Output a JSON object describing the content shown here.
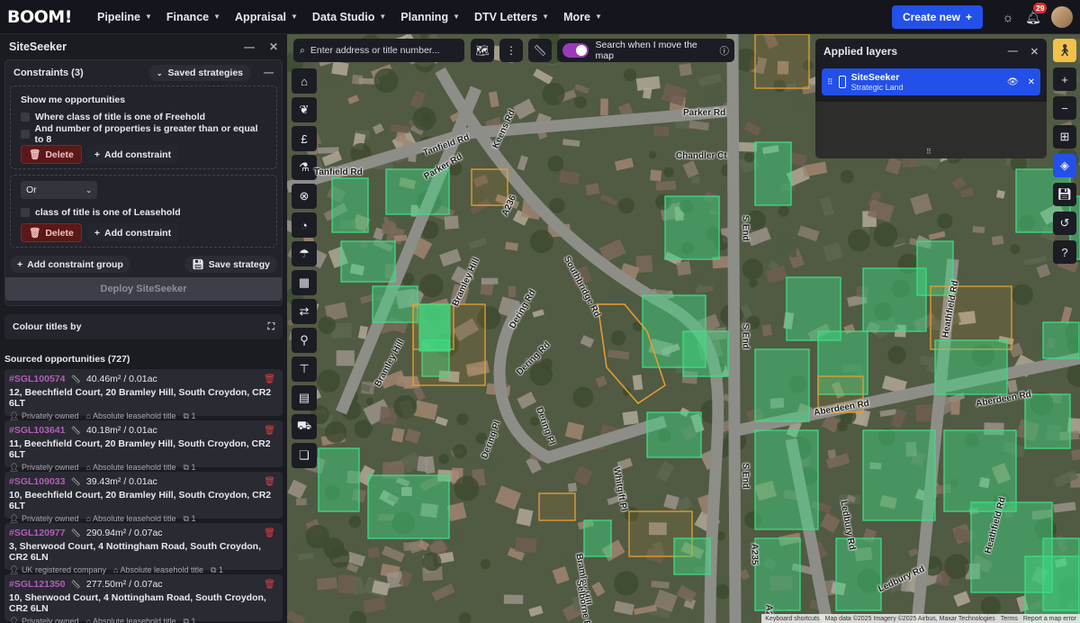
{
  "topbar": {
    "logo": "BOOM!",
    "nav": [
      "Pipeline",
      "Finance",
      "Appraisal",
      "Data Studio",
      "Planning",
      "DTV Letters",
      "More"
    ],
    "create_label": "Create new",
    "notification_count": "29",
    "icons": [
      "plus-icon",
      "sun-icon",
      "bell-icon",
      "avatar"
    ]
  },
  "panel": {
    "title": "SiteSeeker",
    "constraints_label": "Constraints (3)",
    "saved_strategies": "Saved strategies",
    "group1": {
      "heading": "Show me opportunities",
      "rows": [
        "Where class of title is one of Freehold",
        "And number of properties is greater than or equal to 8"
      ]
    },
    "group2": {
      "operator": "Or",
      "rows": [
        "class of title is one of Leasehold"
      ]
    },
    "delete_label": "Delete",
    "add_constraint_label": "Add constraint",
    "add_group_label": "Add constraint group",
    "save_strategy_label": "Save strategy",
    "deploy_label": "Deploy SiteSeeker",
    "colour_label": "Colour titles by",
    "sourced_label": "Sourced opportunities (727)",
    "opportunities": [
      {
        "id": "#SGL100574",
        "area": "40.46m² / 0.01ac",
        "address": "12, Beechfield Court, 20 Bramley Hill, South Croydon, CR2 6LT",
        "owner": "Privately owned",
        "tenure": "Absolute leasehold title",
        "count": "1"
      },
      {
        "id": "#SGL103641",
        "area": "40.18m² / 0.01ac",
        "address": "11, Beechfield Court, 20 Bramley Hill, South Croydon, CR2 6LT",
        "owner": "Privately owned",
        "tenure": "Absolute leasehold title",
        "count": "1"
      },
      {
        "id": "#SGL109033",
        "area": "39.43m² / 0.01ac",
        "address": "10, Beechfield Court, 20 Bramley Hill, South Croydon, CR2 6LT",
        "owner": "Privately owned",
        "tenure": "Absolute leasehold title",
        "count": "1"
      },
      {
        "id": "#SGL120977",
        "area": "290.94m² / 0.07ac",
        "address": "3, Sherwood Court, 4 Nottingham Road, South Croydon, CR2 6LN",
        "owner": "UK registered company",
        "tenure": "Absolute leasehold title",
        "count": "1"
      },
      {
        "id": "#SGL121350",
        "area": "277.50m² / 0.07ac",
        "address": "10, Sherwood Court, 4 Nottingham Road, South Croydon, CR2 6LN",
        "owner": "Privately owned",
        "tenure": "Absolute leasehold title",
        "count": "1"
      }
    ]
  },
  "map": {
    "search_placeholder": "Enter address or title number...",
    "search_move_label": "Search when I move the map",
    "layers_title": "Applied layers",
    "layer_name": "SiteSeeker",
    "layer_sub": "Strategic Land",
    "attribution": [
      "Keyboard shortcuts",
      "Map data ©2025 Imagery ©2025 Airbus, Maxar Technologies",
      "Terms",
      "Report a map error"
    ],
    "roads": [
      "Parker Rd",
      "Keens Rd",
      "Tanfield Rd",
      "Tanfield Rd",
      "Parker Rd",
      "Chandler Ct",
      "A236",
      "Southbridge Rd",
      "Bramley Hill",
      "Bramley Hill",
      "Dering Rd",
      "Dering Rd",
      "Dering Pl",
      "Dering Pl",
      "Whitgift Pl",
      "Bramley Hill",
      "S End",
      "S End",
      "S End",
      "A235",
      "A235",
      "Heathfield Rd",
      "Heathfield Rd",
      "Aberdeen Rd",
      "Aberdeen Rd",
      "Ledbury Rd",
      "Ledbury Rd",
      "Selborne Rd"
    ]
  },
  "colors": {
    "accent": "#2350e8",
    "opportunity_id": "#b25fb8",
    "delete": "#d94040",
    "parcel_green": "#3ddc84",
    "parcel_orange": "#e8a030"
  }
}
